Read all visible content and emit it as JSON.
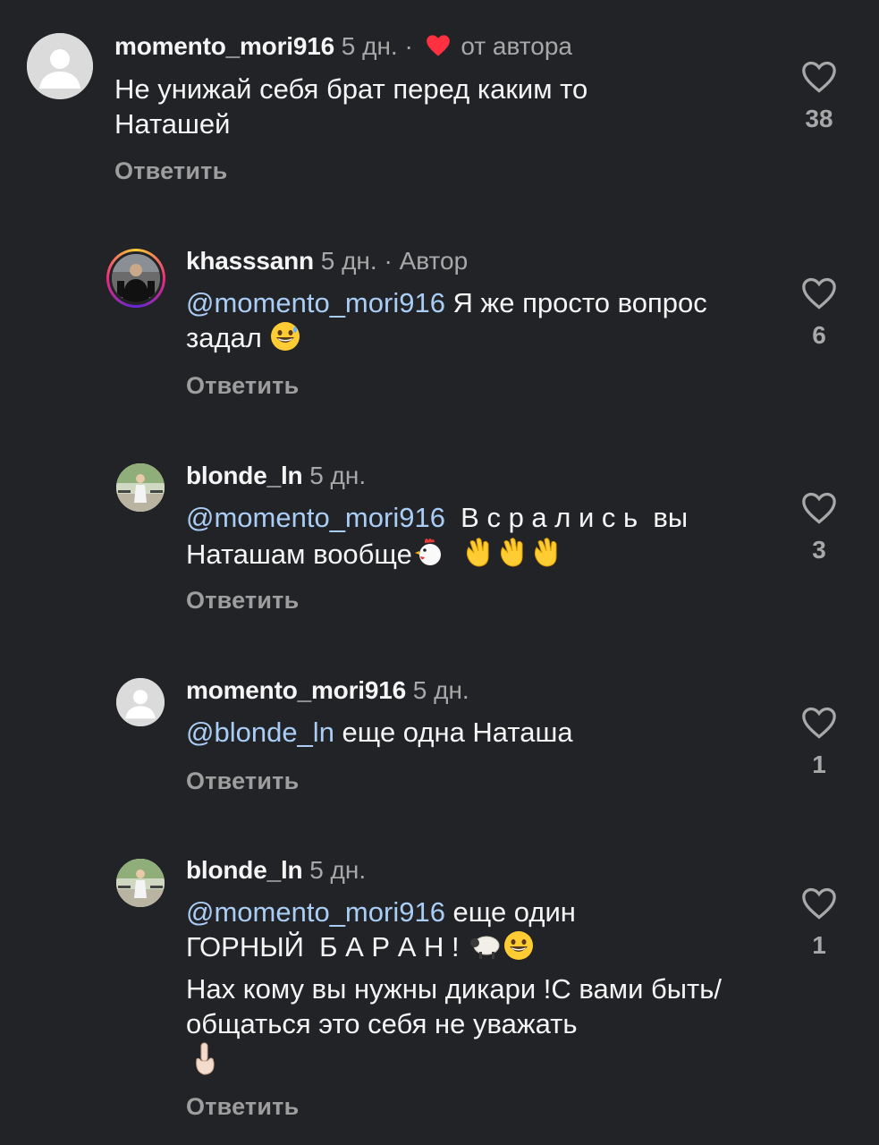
{
  "comments": [
    {
      "username": "momento_mori916",
      "time": "5 дн.",
      "separator": "·",
      "badge": "от автора",
      "text": "Не унижай себя брат перед каким то Наташей",
      "reply_label": "Ответить",
      "likes": "38"
    },
    {
      "username": "khasssann",
      "time": "5 дн.",
      "separator": "·",
      "badge": "Автор",
      "mention": "@momento_mori916",
      "text": " Я же просто вопрос задал ",
      "reply_label": "Ответить",
      "likes": "6"
    },
    {
      "username": "blonde_ln",
      "time": "5 дн.",
      "mention": "@momento_mori916",
      "text": "  В с р а л и с ь  вы Наташам вообще",
      "reply_label": "Ответить",
      "likes": "3"
    },
    {
      "username": "momento_mori916",
      "time": "5 дн.",
      "mention": "@blonde_ln",
      "text": " еще одна Наташа",
      "reply_label": "Ответить",
      "likes": "1"
    },
    {
      "username": "blonde_ln",
      "time": "5 дн.",
      "mention": "@momento_mori916",
      "text": " еще один ГОРНЫЙ  Б А Р А Н ! ",
      "text2": "Нах кому вы нужны дикари !С вами быть/общаться  это себя не уважать",
      "reply_label": "Ответить",
      "likes": "1"
    }
  ],
  "colors": {
    "background": "#222327",
    "mention": "#a9cdf5",
    "heart_red": "#ff3040",
    "secondary_text": "#a8a8a8"
  },
  "icons": [
    "heart-outline-icon",
    "heart-filled-icon",
    "default-avatar-icon"
  ]
}
